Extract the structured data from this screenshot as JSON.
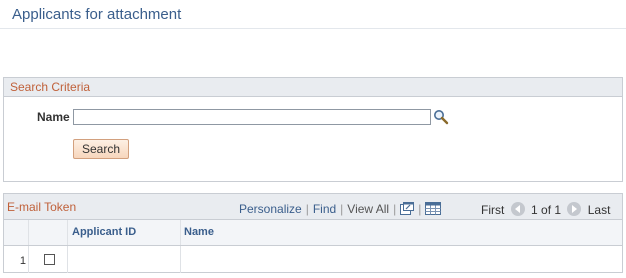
{
  "page": {
    "title": "Applicants for attachment"
  },
  "search": {
    "group_title": "Search Criteria",
    "name_label": "Name",
    "name_value": "",
    "search_button": "Search"
  },
  "grid": {
    "title": "E-mail Token",
    "nav": {
      "personalize": "Personalize",
      "sep": "|",
      "find": "Find",
      "view_all": "View All"
    },
    "pager": {
      "first": "First",
      "range": "1 of 1",
      "last": "Last"
    },
    "columns": [
      "",
      "",
      "Applicant ID",
      "Name"
    ],
    "rows": [
      {
        "num": "1",
        "checked": false,
        "applicant_id": "",
        "name": ""
      }
    ]
  },
  "colors": {
    "accent": "#3a5e8c",
    "header_text": "#c0613a",
    "header_bg": "#e9ecf0",
    "button_bg": "#f7d6bc"
  }
}
